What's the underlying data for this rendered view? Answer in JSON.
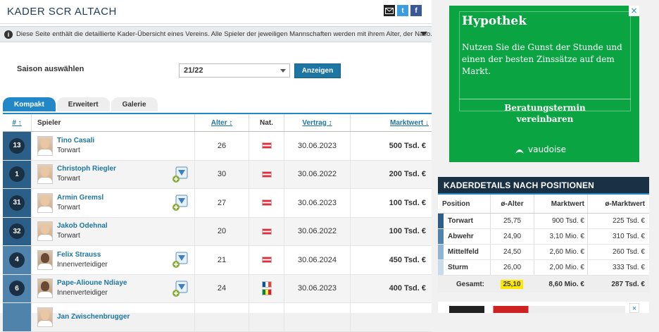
{
  "header": {
    "title": "KADER SCR ALTACH"
  },
  "share": {
    "email_icon": "envelope-icon",
    "twitter_icon": "twitter-icon",
    "facebook_icon": "facebook-icon",
    "twitter_label": "t",
    "facebook_label": "f"
  },
  "info": {
    "text": "Diese Seite enthält die detaillierte Kader-Übersicht eines Vereins. Alle Spieler der jeweiligen Mannschaften werden mit ihrem Alter, der Natio..."
  },
  "season": {
    "label": "Saison auswählen",
    "value": "21/22",
    "button": "Anzeigen"
  },
  "tabs": [
    "Kompakt",
    "Erweitert",
    "Galerie"
  ],
  "table": {
    "headers": {
      "num": "# ↑",
      "player": "Spieler",
      "age": "Alter ↕",
      "nat": "Nat.",
      "contract": "Vertrag ↕",
      "value": "Marktwert ↓"
    },
    "rows": [
      {
        "num": "13",
        "name": "Tino Casali",
        "pos": "Torwart",
        "age": "26",
        "nat": [
          "at"
        ],
        "contract": "30.06.2023",
        "value": "500 Tsd. €",
        "club": false
      },
      {
        "num": "1",
        "name": "Christoph Riegler",
        "pos": "Torwart",
        "age": "30",
        "nat": [
          "at"
        ],
        "contract": "30.06.2022",
        "value": "200 Tsd. €",
        "club": true
      },
      {
        "num": "31",
        "name": "Armin Gremsl",
        "pos": "Torwart",
        "age": "27",
        "nat": [
          "at"
        ],
        "contract": "30.06.2023",
        "value": "100 Tsd. €",
        "club": true
      },
      {
        "num": "32",
        "name": "Jakob Odehnal",
        "pos": "Torwart",
        "age": "20",
        "nat": [
          "at"
        ],
        "contract": "30.06.2022",
        "value": "100 Tsd. €",
        "club": false
      },
      {
        "num": "4",
        "name": "Felix Strauss",
        "pos": "Innenverteidiger",
        "age": "21",
        "nat": [
          "at"
        ],
        "contract": "30.06.2024",
        "value": "450 Tsd. €",
        "club": true
      },
      {
        "num": "6",
        "name": "Pape-Alioune Ndiaye",
        "pos": "Innenverteidiger",
        "age": "24",
        "nat": [
          "fr",
          "sn"
        ],
        "contract": "30.06.2023",
        "value": "400 Tsd. €",
        "club": true
      },
      {
        "num": "",
        "name": "Jan Zwischenbrugger",
        "pos": "",
        "age": "",
        "nat": [],
        "contract": "",
        "value": "",
        "club": false
      }
    ]
  },
  "ad": {
    "title": "Hypothek",
    "text": "Nutzen Sie die Gunst der Stunde und einen der besten Zinssätze auf dem Markt.",
    "cta_line1": "Beratungstermin",
    "cta_line2": "vereinbaren",
    "brand": "vaudoise",
    "close": "×"
  },
  "kader": {
    "title": "KADERDETAILS NACH POSITIONEN",
    "headers": {
      "pos": "Position",
      "age": "ø-Alter",
      "mw": "Marktwert",
      "omw": "ø-Marktwert"
    },
    "rows": [
      {
        "pos": "Torwart",
        "age": "25,75",
        "mw": "900 Tsd. €",
        "omw": "225 Tsd. €",
        "color": "#2c5f87"
      },
      {
        "pos": "Abwehr",
        "age": "24,90",
        "mw": "3,10 Mio. €",
        "omw": "310 Tsd. €",
        "color": "#4f83ac"
      },
      {
        "pos": "Mittelfeld",
        "age": "24,50",
        "mw": "2,60 Mio. €",
        "omw": "260 Tsd. €",
        "color": "#8fb3d0"
      },
      {
        "pos": "Sturm",
        "age": "26,00",
        "mw": "2,00 Mio. €",
        "omw": "333 Tsd. €",
        "color": "#c8dbea"
      }
    ],
    "total": {
      "label": "Gesamt:",
      "age": "25,10",
      "mw": "8,60 Mio. €",
      "omw": "287 Tsd. €"
    }
  },
  "ad2": {
    "close": "×"
  }
}
